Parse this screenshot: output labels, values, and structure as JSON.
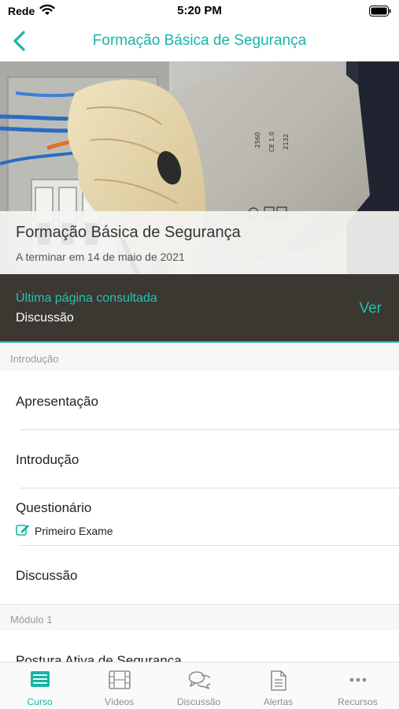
{
  "status_bar": {
    "carrier": "Rede",
    "time": "5:20 PM"
  },
  "nav": {
    "title": "Formação Básica de Segurança",
    "back_icon": "chevron-left-icon",
    "accent_color": "#1ab3a6"
  },
  "hero": {
    "title": "Formação Básica de Segurança",
    "subtitle": "A terminar em 14 de maio de 2021",
    "glove_markings": [
      "2560",
      "CE 1.0",
      "2132"
    ]
  },
  "last_page": {
    "label": "Última página consultada",
    "value": "Discussão",
    "action": "Ver"
  },
  "sections": [
    {
      "header": "Introdução",
      "items": [
        {
          "label": "Apresentação"
        },
        {
          "label": "Introdução"
        },
        {
          "label": "Questionário",
          "sub_label": "Primeiro Exame",
          "sub_icon": "edit-icon"
        },
        {
          "label": "Discussão"
        }
      ]
    },
    {
      "header": "Módulo 1",
      "items": [
        {
          "label": "Postura Ativa de Segurança"
        }
      ]
    }
  ],
  "tab_bar": {
    "active": "Curso",
    "tabs": [
      {
        "label": "Curso",
        "icon": "list-icon"
      },
      {
        "label": "Vídeos",
        "icon": "film-icon"
      },
      {
        "label": "Discussão",
        "icon": "chat-bubbles-icon"
      },
      {
        "label": "Alertas",
        "icon": "document-icon"
      },
      {
        "label": "Recursos",
        "icon": "more-icon"
      }
    ]
  }
}
